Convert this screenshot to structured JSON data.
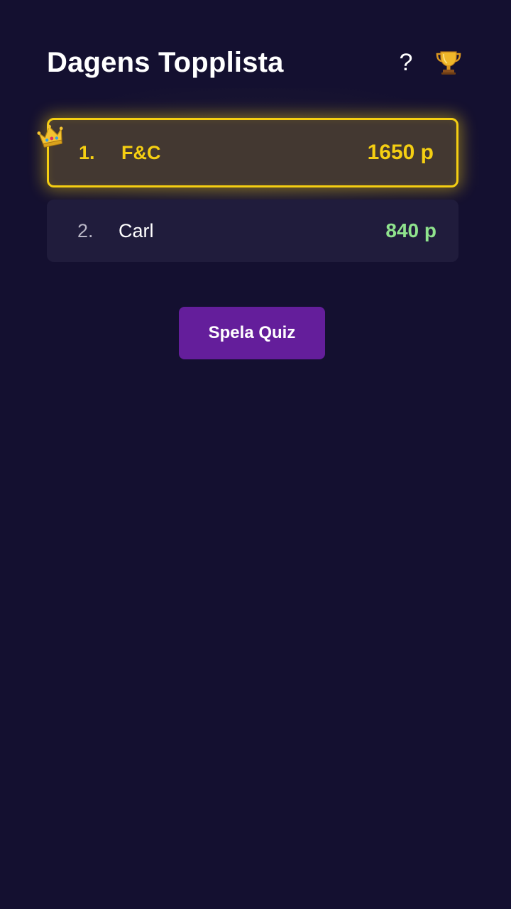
{
  "header": {
    "title": "Dagens Topplista",
    "help_label": "?",
    "trophy_icon": "trophy-icon"
  },
  "leaderboard": {
    "entries": [
      {
        "rank": "1.",
        "name": "F&C",
        "score": "1650 p",
        "highlighted": true,
        "badge_icon": "crown-icon"
      },
      {
        "rank": "2.",
        "name": "Carl",
        "score": "840 p",
        "highlighted": false
      }
    ]
  },
  "actions": {
    "play_label": "Spela Quiz"
  },
  "colors": {
    "background": "#141030",
    "gold": "#f5cf12",
    "score_green": "#8fe38d",
    "button_purple": "#641e9b"
  }
}
